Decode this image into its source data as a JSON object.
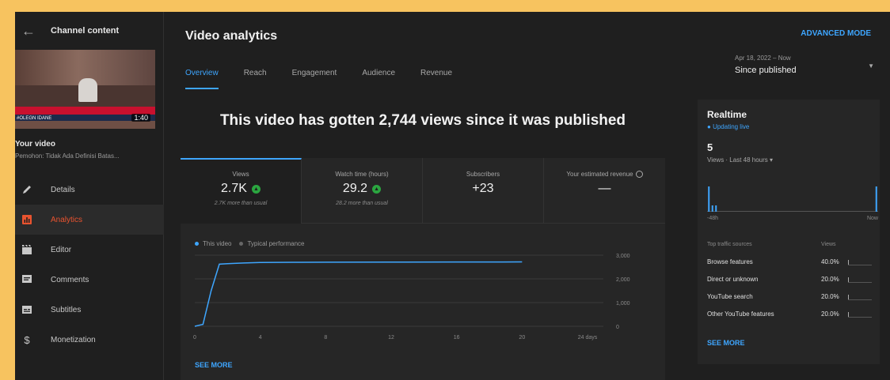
{
  "sidebar": {
    "back_icon": "arrow-left-icon",
    "title": "Channel content",
    "thumbnail": {
      "duration": "1:40",
      "ticker": "#OLEGN IDANE"
    },
    "your_video_label": "Your video",
    "video_subtitle": "Pemohon: Tidak Ada Definisi Batas...",
    "items": [
      {
        "label": "Details",
        "icon": "pencil-icon",
        "active": false
      },
      {
        "label": "Analytics",
        "icon": "analytics-icon",
        "active": true
      },
      {
        "label": "Editor",
        "icon": "clapperboard-icon",
        "active": false
      },
      {
        "label": "Comments",
        "icon": "comment-icon",
        "active": false
      },
      {
        "label": "Subtitles",
        "icon": "subtitles-icon",
        "active": false
      },
      {
        "label": "Monetization",
        "icon": "dollar-icon",
        "active": false
      }
    ]
  },
  "header": {
    "title": "Video analytics",
    "advanced_mode": "ADVANCED MODE",
    "tabs": [
      "Overview",
      "Reach",
      "Engagement",
      "Audience",
      "Revenue"
    ],
    "date_range": "Apr 18, 2022 – Now",
    "date_label": "Since published"
  },
  "headline": "This video has gotten 2,744 views since it was published",
  "metrics": [
    {
      "label": "Views",
      "value": "2.7K",
      "up": true,
      "sub": "2.7K more than usual"
    },
    {
      "label": "Watch time (hours)",
      "value": "29.2",
      "up": true,
      "sub": "28.2 more than usual"
    },
    {
      "label": "Subscribers",
      "value": "+23",
      "up": false,
      "sub": ""
    },
    {
      "label": "Your estimated revenue",
      "value": "—",
      "up": false,
      "sub": ""
    }
  ],
  "legend": {
    "this_video": "This video",
    "typical": "Typical performance"
  },
  "see_more": "SEE MORE",
  "colors": {
    "accent": "#3ea6ff",
    "up": "#2ba640",
    "active_nav": "#e8532f"
  },
  "chart_data": {
    "type": "line",
    "x": [
      0,
      0.5,
      1,
      1.5,
      2,
      3,
      4,
      6,
      8,
      12,
      16,
      20
    ],
    "series": [
      {
        "name": "This video",
        "values": [
          0,
          80,
          1500,
          2620,
          2640,
          2670,
          2690,
          2700,
          2705,
          2710,
          2712,
          2715
        ]
      }
    ],
    "x_ticks": [
      "0",
      "4",
      "8",
      "12",
      "16",
      "20",
      "24 days"
    ],
    "y_ticks": [
      "0",
      "1,000",
      "2,000",
      "3,000"
    ],
    "xlim": [
      0,
      24
    ],
    "ylim": [
      0,
      3000
    ],
    "xlabel": "",
    "ylabel": ""
  },
  "realtime": {
    "title": "Realtime",
    "live": "Updating live",
    "count": "5",
    "period": "Views · Last 48 hours",
    "axis_start": "-48h",
    "axis_end": "Now",
    "bars": [
      4,
      1,
      1,
      0,
      0,
      0,
      0,
      0,
      0,
      0,
      0,
      0,
      0,
      0,
      0,
      0,
      0,
      0,
      0,
      0,
      0,
      0,
      0,
      0,
      0,
      0,
      0,
      0,
      0,
      0,
      0,
      0,
      0,
      0,
      0,
      0,
      0,
      0,
      0,
      0,
      0,
      0,
      0,
      0,
      0,
      0,
      0,
      4
    ],
    "sources_header": "Top traffic sources",
    "views_header": "Views",
    "sources": [
      {
        "name": "Browse features",
        "pct": "40.0%",
        "fraction": 0.4
      },
      {
        "name": "Direct or unknown",
        "pct": "20.0%",
        "fraction": 0.2
      },
      {
        "name": "YouTube search",
        "pct": "20.0%",
        "fraction": 0.2
      },
      {
        "name": "Other YouTube features",
        "pct": "20.0%",
        "fraction": 0.2
      }
    ]
  }
}
